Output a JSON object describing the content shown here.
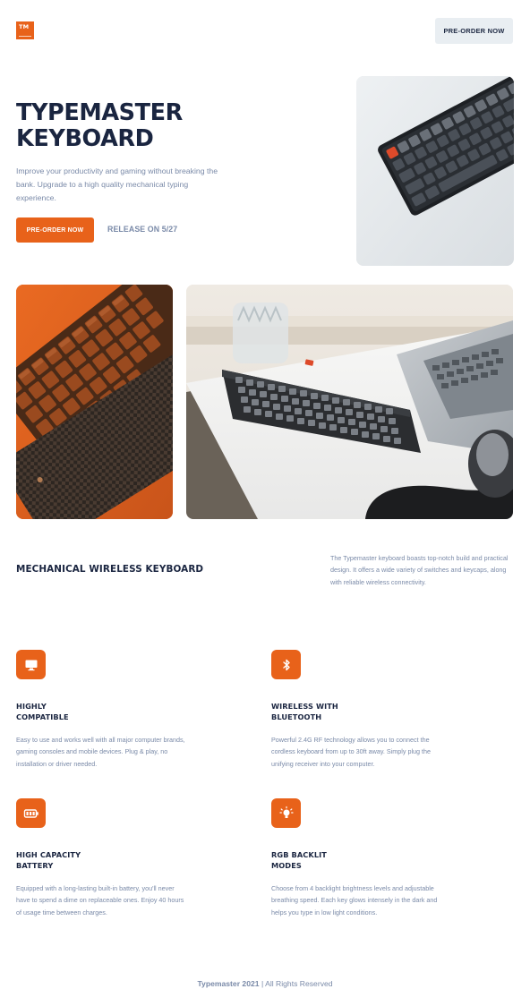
{
  "brand": {
    "logo_text": "TM",
    "accent": "#e8621a",
    "navy": "#1a2540",
    "muted": "#7a8aa8"
  },
  "header": {
    "preorder_label": "PRE-ORDER NOW"
  },
  "hero": {
    "title": "TYPEMASTER\nKEYBOARD",
    "description": "Improve your productivity and gaming without breaking the bank. Upgrade to a high quality mechanical typing experience.",
    "cta_label": "PRE-ORDER NOW",
    "release_label": "RELEASE ON 5/27"
  },
  "intro": {
    "title": "MECHANICAL WIRELESS KEYBOARD",
    "description": "The Typemaster keyboard boasts top-notch build and practical design. It offers a wide variety of switches and keycaps, along with reliable wireless connectivity."
  },
  "features": [
    {
      "icon": "monitor-icon",
      "title": "HIGHLY\nCOMPATIBLE",
      "text": "Easy to use and works well with all major computer brands,\ngaming consoles and mobile devices. Plug & play, no\ninstallation or driver needed."
    },
    {
      "icon": "bluetooth-icon",
      "title": "WIRELESS WITH\nBLUETOOTH",
      "text": "Powerful 2.4G RF technology allows you to connect the\ncordless keyboard from up to 30ft away. Simply plug the\nunifying receiver into your computer."
    },
    {
      "icon": "battery-icon",
      "title": "HIGH CAPACITY\nBATTERY",
      "text": "Equipped with a long-lasting built-in battery, you'll never\nhave to spend a dime on replaceable ones.  Enjoy 40 hours\nof usage time between charges."
    },
    {
      "icon": "lightbulb-icon",
      "title": "RGB BACKLIT\nMODES",
      "text": "Choose from 4 backlight brightness levels and adjustable\nbreathing speed. Each key glows intensely in the dark and\nhelps you type in low light conditions."
    }
  ],
  "footer": {
    "brand_year": "Typemaster 2021",
    "rights": " | All Rights Reserved"
  }
}
